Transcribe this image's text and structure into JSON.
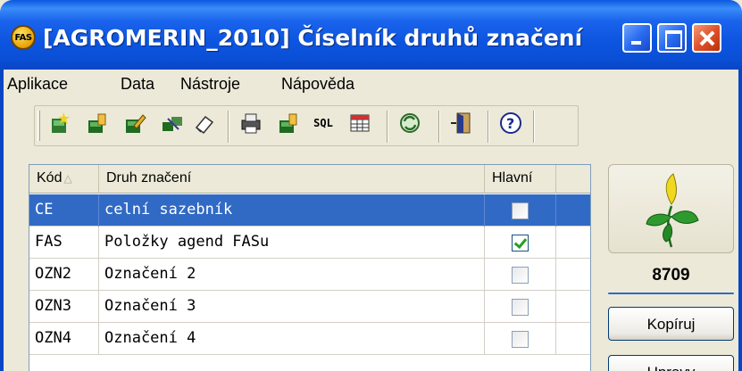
{
  "window": {
    "icon_label": "FAS",
    "title": "[AGROMERIN_2010] Číselník druhů značení"
  },
  "menu": [
    "Aplikace",
    "Data",
    "Nástroje",
    "Nápověda"
  ],
  "toolbar": {
    "sql_label": "SQL"
  },
  "grid": {
    "columns": [
      "Kód",
      "Druh značení",
      "Hlavní"
    ],
    "sort_indicator": "△",
    "rows": [
      {
        "code": "CE",
        "name": "celní sazebník",
        "main": false,
        "selected": true
      },
      {
        "code": "FAS",
        "name": "Položky agend FASu",
        "main": true,
        "selected": false
      },
      {
        "code": "OZN2",
        "name": "Označení 2",
        "main": false,
        "selected": false
      },
      {
        "code": "OZN3",
        "name": "Označení 3",
        "main": false,
        "selected": false
      },
      {
        "code": "OZN4",
        "name": "Označení 4",
        "main": false,
        "selected": false
      }
    ]
  },
  "side": {
    "count": "8709",
    "copy_button": "Kopíruj",
    "next_button": "Upravy"
  },
  "colors": {
    "titlebar": "#0a4fd6",
    "selection": "#316ac5",
    "check_green": "#21a121"
  }
}
